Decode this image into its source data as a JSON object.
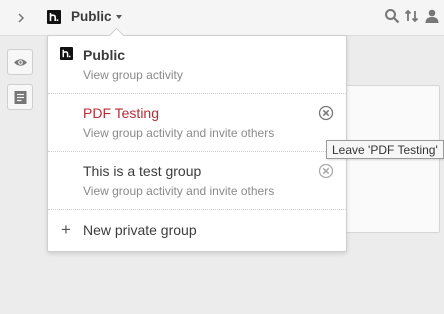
{
  "topbar": {
    "collapse_icon": "chevron-right-icon",
    "group_name": "Public",
    "icons": [
      "search-icon",
      "sort-icon",
      "user-icon"
    ]
  },
  "left_rail": {
    "buttons": [
      "eye-icon",
      "page-notes-icon"
    ]
  },
  "dropdown": {
    "items": [
      {
        "title": "Public",
        "subtitle": "View group activity",
        "icon": "hypothesis-logo-icon"
      },
      {
        "title": "PDF Testing",
        "subtitle": "View group activity and invite others",
        "action_icon": "leave-icon"
      },
      {
        "title": "This is a test group",
        "subtitle": "View group activity and invite others",
        "action_icon": "leave-icon"
      }
    ],
    "new_group_label": "New private group"
  },
  "tooltip": {
    "text": "Leave 'PDF Testing'"
  },
  "colors": {
    "active_group": "#b52d35",
    "topbar_bg": "#f5f5f5",
    "page_bg": "#ececec"
  }
}
